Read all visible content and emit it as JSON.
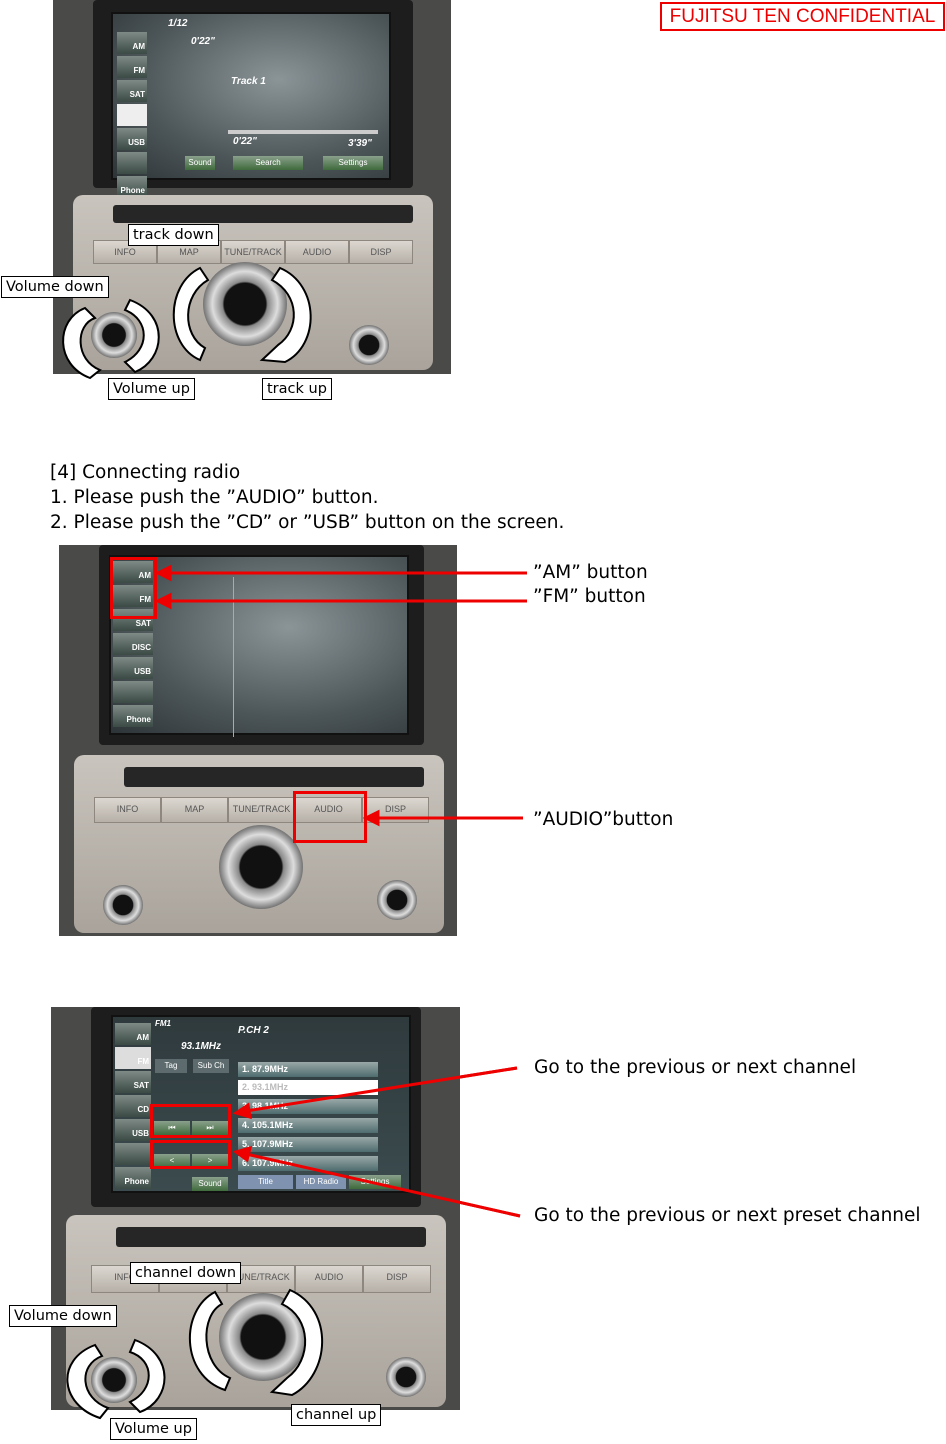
{
  "header": {
    "confidential": "FUJITSU TEN CONFIDENTIAL"
  },
  "section1": {
    "labels": {
      "track_down": "track down",
      "volume_down": "Volume down",
      "volume_up": "Volume up",
      "track_up": "track up"
    },
    "screen": {
      "top": "1/12",
      "time": "0'22\"",
      "track": "Track 1",
      "elapsed": "0'22\"",
      "total": "3'39\"",
      "buttons": [
        "Sound",
        "Search",
        "Settings"
      ],
      "side": [
        "AM",
        "FM",
        "SAT",
        "",
        "USB",
        "",
        "Phone"
      ]
    },
    "panel_buttons": [
      "INFO",
      "MAP",
      "TUNE/TRACK",
      "AUDIO",
      "DISP"
    ]
  },
  "section2": {
    "heading": "[4] Connecting radio",
    "step1": "1. Please push the ”AUDIO” button.",
    "step2": "2. Please push the ”CD” or ”USB” button on the screen.",
    "callouts": {
      "am": "”AM” button",
      "fm": "”FM” button",
      "audio": "”AUDIO”button"
    },
    "screen": {
      "side": [
        "AM",
        "FM",
        "SAT",
        "DISC",
        "USB",
        "",
        "Phone"
      ]
    },
    "panel_buttons": [
      "INFO",
      "MAP",
      "TUNE/TRACK",
      "AUDIO",
      "DISP"
    ]
  },
  "section3": {
    "callouts": {
      "channel": "Go to the previous or next channel",
      "preset": "Go to the previous or next preset channel"
    },
    "labels": {
      "channel_down": "channel down",
      "volume_down": "Volume down",
      "volume_up": "Volume up",
      "channel_up": "channel up"
    },
    "screen": {
      "band": "FM1",
      "preset_ch": "P.CH 2",
      "freq": "93.1MHz",
      "tag": "Tag",
      "subch": "Sub Ch",
      "presets": [
        "1. 87.9MHz",
        "2. 93.1MHz",
        "3. 98.1MHz",
        "4. 105.1MHz",
        "5. 107.9MHz",
        "6. 107.9MHz"
      ],
      "seek": [
        "⏮",
        "⏭"
      ],
      "preset_nav": [
        "<",
        ">"
      ],
      "bottom": [
        "Sound",
        "Title",
        "HD Radio",
        "Settings"
      ],
      "side": [
        "AM",
        "FM",
        "SAT",
        "CD",
        "USB",
        "",
        "Phone"
      ]
    },
    "panel_buttons": [
      "INFO",
      "MAP",
      "TUNE/TRACK",
      "AUDIO",
      "DISP"
    ]
  },
  "colors": {
    "accent_red": "#ee0000"
  }
}
